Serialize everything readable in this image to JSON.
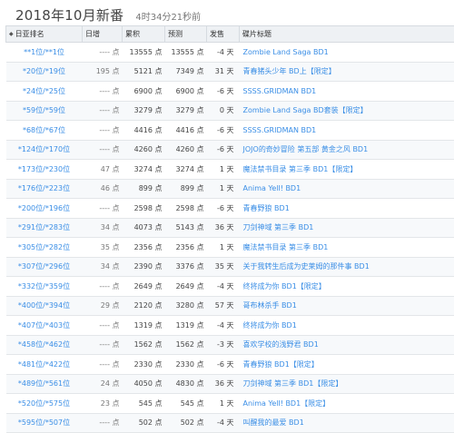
{
  "header": {
    "title": "2018年10月新番",
    "subtitle": "4时34分21秒前"
  },
  "table": {
    "headers": [
      "日亚排名",
      "日增",
      "累积",
      "预测",
      "发售",
      "碟片标题"
    ],
    "rows": [
      {
        "rank": "**1位/**1位",
        "daily": "---- 点",
        "total": "13555 点",
        "forecast": "13555 点",
        "release": "-4 天",
        "title": "Zombie Land Saga BD1"
      },
      {
        "rank": "*20位/*19位",
        "daily": "195 点",
        "total": "5121 点",
        "forecast": "7349 点",
        "release": "31 天",
        "title": "青春猪头少年 BD上【限定】"
      },
      {
        "rank": "*24位/*25位",
        "daily": "---- 点",
        "total": "6900 点",
        "forecast": "6900 点",
        "release": "-6 天",
        "title": "SSSS.GRIDMAN BD1"
      },
      {
        "rank": "*59位/*59位",
        "daily": "---- 点",
        "total": "3279 点",
        "forecast": "3279 点",
        "release": "0 天",
        "title": "Zombie Land Saga BD套装【限定】"
      },
      {
        "rank": "*68位/*67位",
        "daily": "---- 点",
        "total": "4416 点",
        "forecast": "4416 点",
        "release": "-6 天",
        "title": "SSSS.GRIDMAN BD1"
      },
      {
        "rank": "*124位/*170位",
        "daily": "---- 点",
        "total": "4260 点",
        "forecast": "4260 点",
        "release": "-6 天",
        "title": "JOJO的奇妙冒险 第五部 黄金之风 BD1"
      },
      {
        "rank": "*173位/*230位",
        "daily": "47 点",
        "total": "3274 点",
        "forecast": "3274 点",
        "release": "1 天",
        "title": "魔法禁书目录 第三季 BD1【限定】"
      },
      {
        "rank": "*176位/*223位",
        "daily": "46 点",
        "total": "899 点",
        "forecast": "899 点",
        "release": "1 天",
        "title": "Anima Yell! BD1"
      },
      {
        "rank": "*200位/*196位",
        "daily": "---- 点",
        "total": "2598 点",
        "forecast": "2598 点",
        "release": "-6 天",
        "title": "青春野狼 BD1"
      },
      {
        "rank": "*291位/*283位",
        "daily": "34 点",
        "total": "4073 点",
        "forecast": "5143 点",
        "release": "36 天",
        "title": "刀剑神域 第三季 BD1"
      },
      {
        "rank": "*305位/*282位",
        "daily": "35 点",
        "total": "2356 点",
        "forecast": "2356 点",
        "release": "1 天",
        "title": "魔法禁书目录 第三季 BD1"
      },
      {
        "rank": "*307位/*296位",
        "daily": "34 点",
        "total": "2390 点",
        "forecast": "3376 点",
        "release": "35 天",
        "title": "关于我转生后成为史莱姆的那件事 BD1"
      },
      {
        "rank": "*332位/*359位",
        "daily": "---- 点",
        "total": "2649 点",
        "forecast": "2649 点",
        "release": "-4 天",
        "title": "终将成为你 BD1【限定】"
      },
      {
        "rank": "*400位/*394位",
        "daily": "29 点",
        "total": "2120 点",
        "forecast": "3280 点",
        "release": "57 天",
        "title": "哥布林杀手 BD1"
      },
      {
        "rank": "*407位/*403位",
        "daily": "---- 点",
        "total": "1319 点",
        "forecast": "1319 点",
        "release": "-4 天",
        "title": "终将成为你 BD1"
      },
      {
        "rank": "*458位/*462位",
        "daily": "---- 点",
        "total": "1562 点",
        "forecast": "1562 点",
        "release": "-3 天",
        "title": "喜欢学校的浅野君 BD1"
      },
      {
        "rank": "*481位/*422位",
        "daily": "---- 点",
        "total": "2330 点",
        "forecast": "2330 点",
        "release": "-6 天",
        "title": "青春野狼 BD1【限定】"
      },
      {
        "rank": "*489位/*561位",
        "daily": "24 点",
        "total": "4050 点",
        "forecast": "4830 点",
        "release": "36 天",
        "title": "刀剑神域 第三季 BD1【限定】"
      },
      {
        "rank": "*520位/*575位",
        "daily": "23 点",
        "total": "545 点",
        "forecast": "545 点",
        "release": "1 天",
        "title": "Anima Yell! BD1【限定】"
      },
      {
        "rank": "*595位/*507位",
        "daily": "---- 点",
        "total": "502 点",
        "forecast": "502 点",
        "release": "-4 天",
        "title": "叫醒我的最爱 BD1"
      }
    ]
  }
}
